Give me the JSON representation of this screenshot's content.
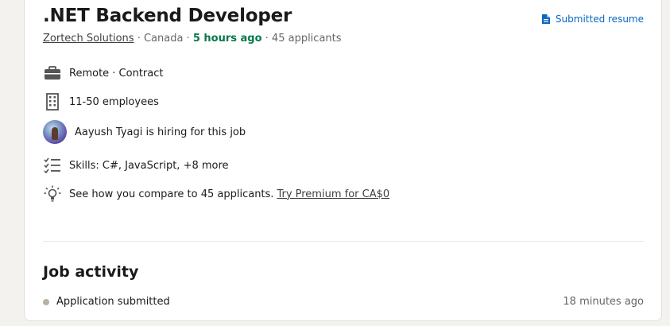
{
  "job": {
    "title": ".NET Backend Developer",
    "company": "Zortech Solutions",
    "location": " · Canada · ",
    "posted": "5 hours ago",
    "applicants": " · 45 applicants"
  },
  "status": {
    "label": "Submitted resume",
    "icon": "document-icon",
    "color": "#0a66c2"
  },
  "details": {
    "workplace": "Remote · Contract",
    "company_size": "11-50 employees",
    "hiring": "Aayush Tyagi is hiring for this job",
    "skills": "Skills: C#, JavaScript, +8 more",
    "compare": "See how you compare to 45 applicants.",
    "premium_link": "Try Premium for CA$0"
  },
  "activity": {
    "title": "Job activity",
    "items": [
      {
        "label": "Application submitted",
        "time": "18 minutes ago"
      }
    ]
  },
  "colors": {
    "posted_time": "#05784a",
    "link": "#0a66c2",
    "background": "#f4f2ee"
  }
}
